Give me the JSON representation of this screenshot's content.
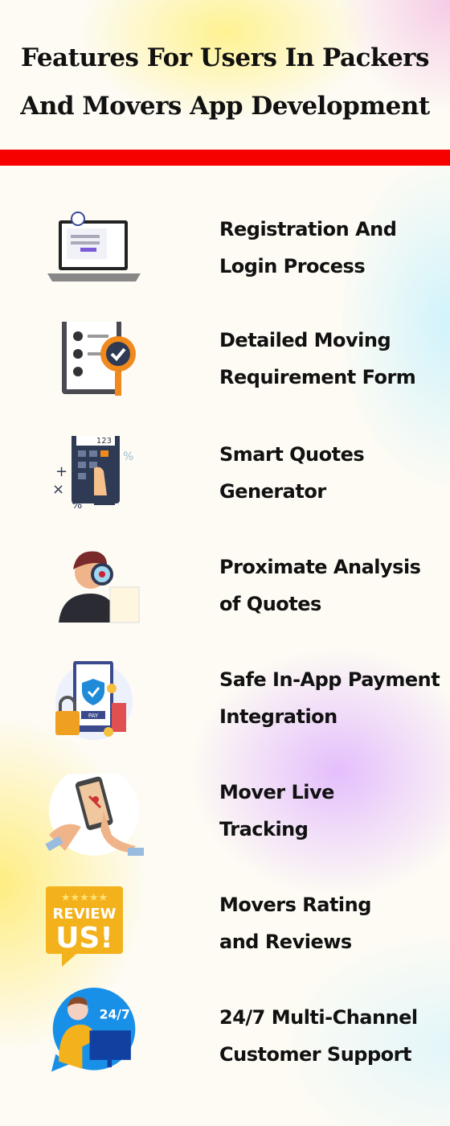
{
  "header": {
    "title_line1": "Features For Users In Packers",
    "title_line2": "And Movers App Development"
  },
  "accent_color": "#f70000",
  "features": [
    {
      "icon": "laptop-login-icon",
      "line1": "Registration And",
      "line2": "Login Process"
    },
    {
      "icon": "clipboard-check-icon",
      "line1": "Detailed Moving",
      "line2": "Requirement Form"
    },
    {
      "icon": "calculator-icon",
      "line1": "Smart Quotes",
      "line2": "Generator",
      "icon_text": "123"
    },
    {
      "icon": "magnifier-analysis-icon",
      "line1": "Proximate Analysis",
      "line2": "of Quotes"
    },
    {
      "icon": "secure-payment-icon",
      "line1": "Safe In-App Payment",
      "line2": "Integration",
      "icon_text": "PAY"
    },
    {
      "icon": "map-tracking-icon",
      "line1": "Mover Live",
      "line2": "Tracking"
    },
    {
      "icon": "review-us-icon",
      "line1": "Movers Rating",
      "line2": "and Reviews",
      "icon_text": "REVIEW US!"
    },
    {
      "icon": "support-24-7-icon",
      "line1": "24/7 Multi-Channel",
      "line2": "Customer Support",
      "icon_text": "24/7"
    }
  ]
}
